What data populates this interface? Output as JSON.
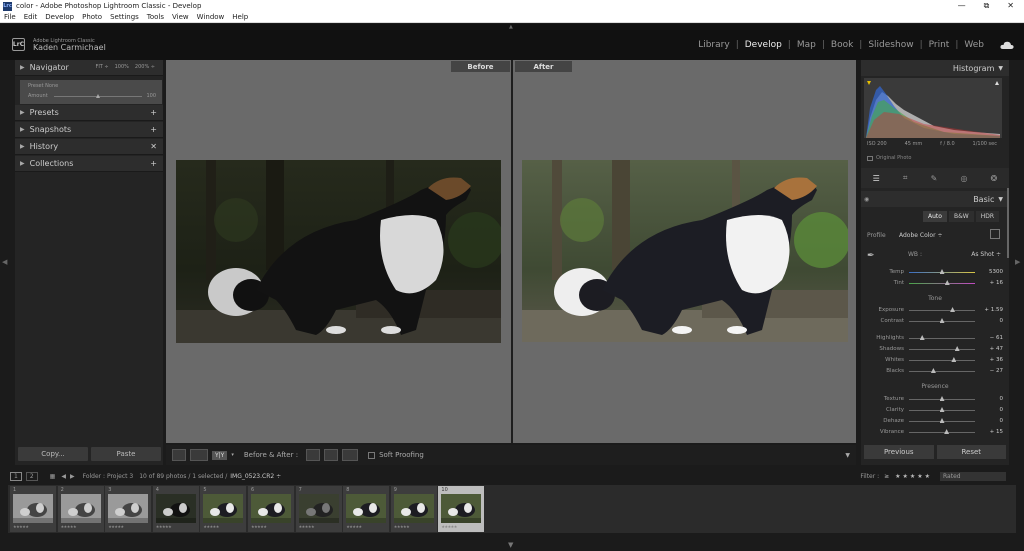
{
  "window": {
    "title": "color - Adobe Photoshop Lightroom Classic - Develop",
    "app_badge": "Lrc",
    "controls": [
      "—",
      "⧉",
      "✕"
    ]
  },
  "menu": [
    "File",
    "Edit",
    "Develop",
    "Photo",
    "Settings",
    "Tools",
    "View",
    "Window",
    "Help"
  ],
  "identity": {
    "badge": "LrC",
    "product": "Adobe Lightroom Classic",
    "user": "Kaden Carmichael"
  },
  "modules": [
    "Library",
    "Develop",
    "Map",
    "Book",
    "Slideshow",
    "Print",
    "Web"
  ],
  "active_module": "Develop",
  "left_panel": {
    "navigator": {
      "label": "Navigator",
      "zoom": [
        "FIT ÷",
        "100%",
        "200% ÷"
      ]
    },
    "preview": {
      "line1": "Preset   None",
      "line2": "Amount",
      "value": "100"
    },
    "sections": [
      {
        "label": "Presets",
        "action": "+"
      },
      {
        "label": "Snapshots",
        "action": "+"
      },
      {
        "label": "History",
        "action": "✕"
      },
      {
        "label": "Collections",
        "action": "+"
      }
    ],
    "copy": "Copy...",
    "paste": "Paste"
  },
  "center": {
    "before_label": "Before",
    "after_label": "After"
  },
  "toolbar": {
    "yy": "Y|Y",
    "before_after": "Before & After :",
    "soft_proofing": "Soft Proofing"
  },
  "right_panel": {
    "histogram_title": "Histogram",
    "meta": [
      "ISO 200",
      "45 mm",
      "f / 8.0",
      "1/100 sec"
    ],
    "original_photo": "Original Photo",
    "basic_title": "Basic",
    "treatment": [
      "Auto",
      "B&W",
      "HDR"
    ],
    "profile_label": "Profile",
    "profile_value": "Adobe Color ÷",
    "wb_label": "WB :",
    "wb_value": "As Shot ÷",
    "sliders_wb": [
      {
        "label": "Temp",
        "value": "5300",
        "pos": 0.5
      },
      {
        "label": "Tint",
        "value": "+ 16",
        "pos": 0.58
      }
    ],
    "tone_title": "Tone",
    "sliders_tone1": [
      {
        "label": "Exposure",
        "value": "+ 1.59",
        "pos": 0.66
      },
      {
        "label": "Contrast",
        "value": "0",
        "pos": 0.5
      }
    ],
    "sliders_tone2": [
      {
        "label": "Highlights",
        "value": "− 61",
        "pos": 0.2
      },
      {
        "label": "Shadows",
        "value": "+ 47",
        "pos": 0.73
      },
      {
        "label": "Whites",
        "value": "+ 36",
        "pos": 0.68
      },
      {
        "label": "Blacks",
        "value": "− 27",
        "pos": 0.37
      }
    ],
    "presence_title": "Presence",
    "sliders_presence": [
      {
        "label": "Texture",
        "value": "0",
        "pos": 0.5
      },
      {
        "label": "Clarity",
        "value": "0",
        "pos": 0.5
      },
      {
        "label": "Dehaze",
        "value": "0",
        "pos": 0.5
      },
      {
        "label": "Vibrance",
        "value": "+ 15",
        "pos": 0.57
      }
    ],
    "previous": "Previous",
    "reset": "Reset"
  },
  "filmstrip_bar": {
    "page1": "1",
    "page2": "2",
    "source": "Folder : Project 3",
    "count": "10 of 89 photos / 1 selected /",
    "filename": "IMG_0523.CR2 ÷",
    "filter_label": "Filter :",
    "filter_stars": "≥ ★★★★★",
    "rated": "Rated"
  },
  "thumbnails": [
    {
      "num": "1",
      "style": "gray"
    },
    {
      "num": "2",
      "style": "gray"
    },
    {
      "num": "3",
      "style": "gray"
    },
    {
      "num": "4",
      "style": "dark"
    },
    {
      "num": "5",
      "style": "color"
    },
    {
      "num": "6",
      "style": "color"
    },
    {
      "num": "7",
      "style": "dim"
    },
    {
      "num": "8",
      "style": "color"
    },
    {
      "num": "9",
      "style": "color"
    },
    {
      "num": "10",
      "style": "color",
      "selected": true
    }
  ],
  "thumb_stars": "★★★★★"
}
